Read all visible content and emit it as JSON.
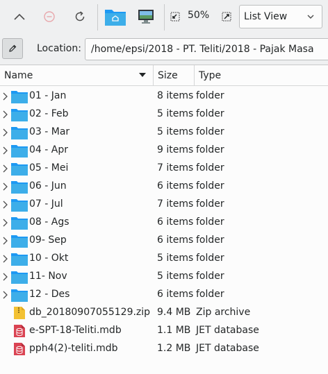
{
  "toolbar": {
    "zoom": "50%",
    "view_mode": "List View"
  },
  "location": {
    "label": "Location:",
    "path": "/home/epsi/2018 - PT. Teliti/2018 - Pajak Masa"
  },
  "columns": {
    "name": "Name",
    "size": "Size",
    "type": "Type"
  },
  "colors": {
    "folder": "#3daee9",
    "zip": "#f3c133",
    "database": "#da4453"
  },
  "files": [
    {
      "name": "01 - Jan",
      "size": "8 items",
      "type": "folder",
      "icon": "folder-icon",
      "expandable": true
    },
    {
      "name": "02 - Feb",
      "size": "5 items",
      "type": "folder",
      "icon": "folder-icon",
      "expandable": true
    },
    {
      "name": "03 - Mar",
      "size": "5 items",
      "type": "folder",
      "icon": "folder-icon",
      "expandable": true
    },
    {
      "name": "04 - Apr",
      "size": "9 items",
      "type": "folder",
      "icon": "folder-icon",
      "expandable": true
    },
    {
      "name": "05 - Mei",
      "size": "7 items",
      "type": "folder",
      "icon": "folder-icon",
      "expandable": true
    },
    {
      "name": "06 - Jun",
      "size": "6 items",
      "type": "folder",
      "icon": "folder-icon",
      "expandable": true
    },
    {
      "name": "07 - Jul",
      "size": "7 items",
      "type": "folder",
      "icon": "folder-icon",
      "expandable": true
    },
    {
      "name": "08 - Ags",
      "size": "6 items",
      "type": "folder",
      "icon": "folder-icon",
      "expandable": true
    },
    {
      "name": "09- Sep",
      "size": "6 items",
      "type": "folder",
      "icon": "folder-icon",
      "expandable": true
    },
    {
      "name": "10 - Okt",
      "size": "5 items",
      "type": "folder",
      "icon": "folder-icon",
      "expandable": true
    },
    {
      "name": "11- Nov",
      "size": "5 items",
      "type": "folder",
      "icon": "folder-icon",
      "expandable": true
    },
    {
      "name": "12 - Des",
      "size": "6 items",
      "type": "folder",
      "icon": "folder-icon",
      "expandable": true
    },
    {
      "name": "db_20180907055129.zip",
      "size": "9.4 MB",
      "type": "Zip archive",
      "icon": "zip-archive-icon",
      "expandable": false
    },
    {
      "name": "e-SPT-18-Teliti.mdb",
      "size": "1.1 MB",
      "type": "JET database",
      "icon": "database-icon",
      "expandable": false
    },
    {
      "name": "pph4(2)-teliti.mdb",
      "size": "1.2 MB",
      "type": "JET database",
      "icon": "database-icon",
      "expandable": false
    }
  ]
}
